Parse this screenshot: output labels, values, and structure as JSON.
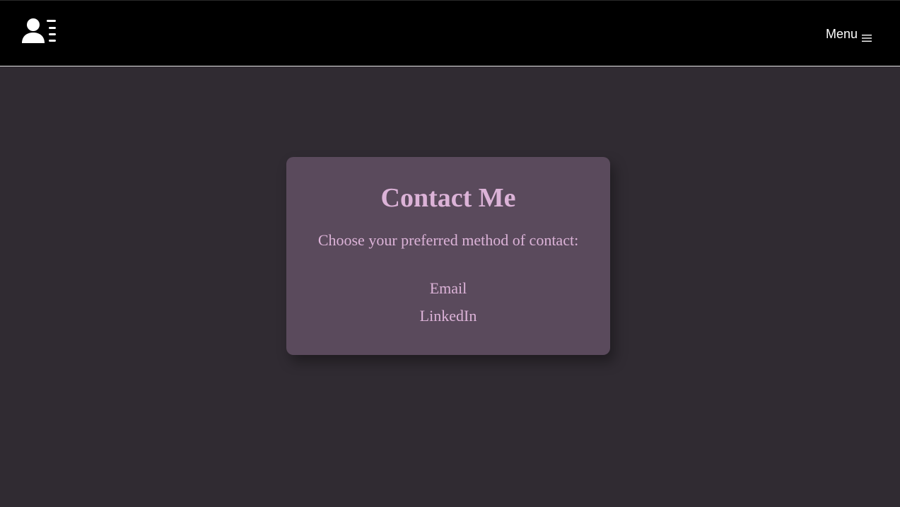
{
  "header": {
    "logo_icon": "person-list-icon",
    "menu_label": "Menu",
    "menu_icon": "hamburger-icon"
  },
  "contact_card": {
    "title": "Contact Me",
    "subtitle": "Choose your preferred method of contact:",
    "options": [
      {
        "label": "Email"
      },
      {
        "label": "LinkedIn"
      }
    ]
  },
  "colors": {
    "page_background": "#302b32",
    "header_background": "#000000",
    "card_background": "#5a4a5c",
    "accent_text": "#dcb3d8",
    "header_text": "#ffffff"
  }
}
